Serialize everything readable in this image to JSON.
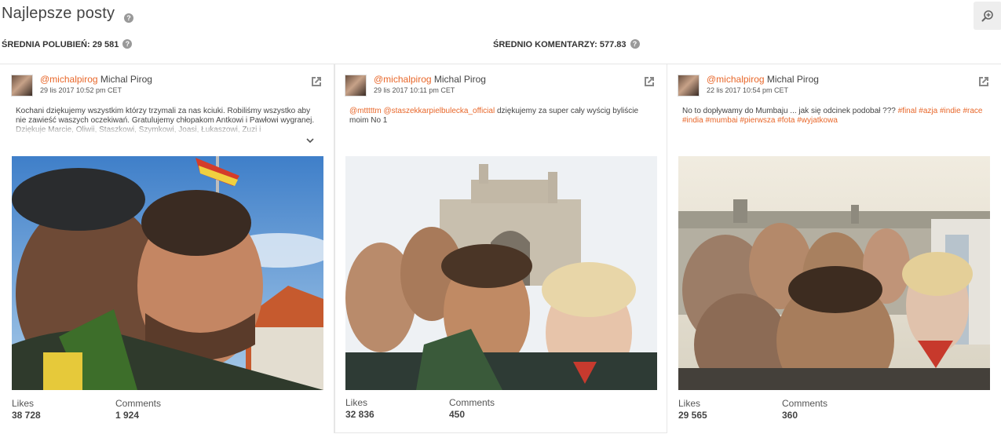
{
  "header": {
    "title": "Najlepsze posty"
  },
  "stats": {
    "avg_likes": "ŚREDNIA POLUBIEŃ: 29 581",
    "avg_comments": "ŚREDNIO KOMENTARZY: 577.83"
  },
  "icons": {
    "help": "help-icon",
    "zoom": "zoom-in-icon",
    "external": "external-link-icon",
    "chevron": "chevron-down-icon"
  },
  "colors": {
    "accent": "#e8672a"
  },
  "posts": [
    {
      "handle": "@michalpirog",
      "name": "Michal Pirog",
      "date": "29 lis 2017 10:52 pm CET",
      "caption_plain": "Kochani dziękujemy wszystkim którzy trzymali za nas kciuki. Robiliśmy wszystko aby nie zawieść waszych oczekiwań. Gratulujemy chłopakom Antkowi i Pawłowi wygranej. Dziękuje Marcie, Oliwii, Staszkowi, Szymkowi, Joasi, Łukaszowi, Zuzi i",
      "likes_label": "Likes",
      "likes": "38 728",
      "comments_label": "Comments",
      "comments": "1 924"
    },
    {
      "handle": "@michalpirog",
      "name": "Michal Pirog",
      "date": "29 lis 2017 10:11 pm CET",
      "mention_1": "@mtttttm",
      "mention_2": "@staszekkarpielbulecka_official",
      "caption_text": " dziękujemy za super cały wyścig byliście moim No 1",
      "likes_label": "Likes",
      "likes": "32 836",
      "comments_label": "Comments",
      "comments": "450"
    },
    {
      "handle": "@michalpirog",
      "name": "Michal Pirog",
      "date": "22 lis 2017 10:54 pm CET",
      "caption_text": "No to dopływamy do Mumbaju ... jak się odcinek podobał ??? ",
      "tags_line1": "#final #azja #indie",
      "tags_line2": "#race #india #mumbai #pierwsza #fota #wyjatkowa",
      "likes_label": "Likes",
      "likes": "29 565",
      "comments_label": "Comments",
      "comments": "360"
    }
  ]
}
